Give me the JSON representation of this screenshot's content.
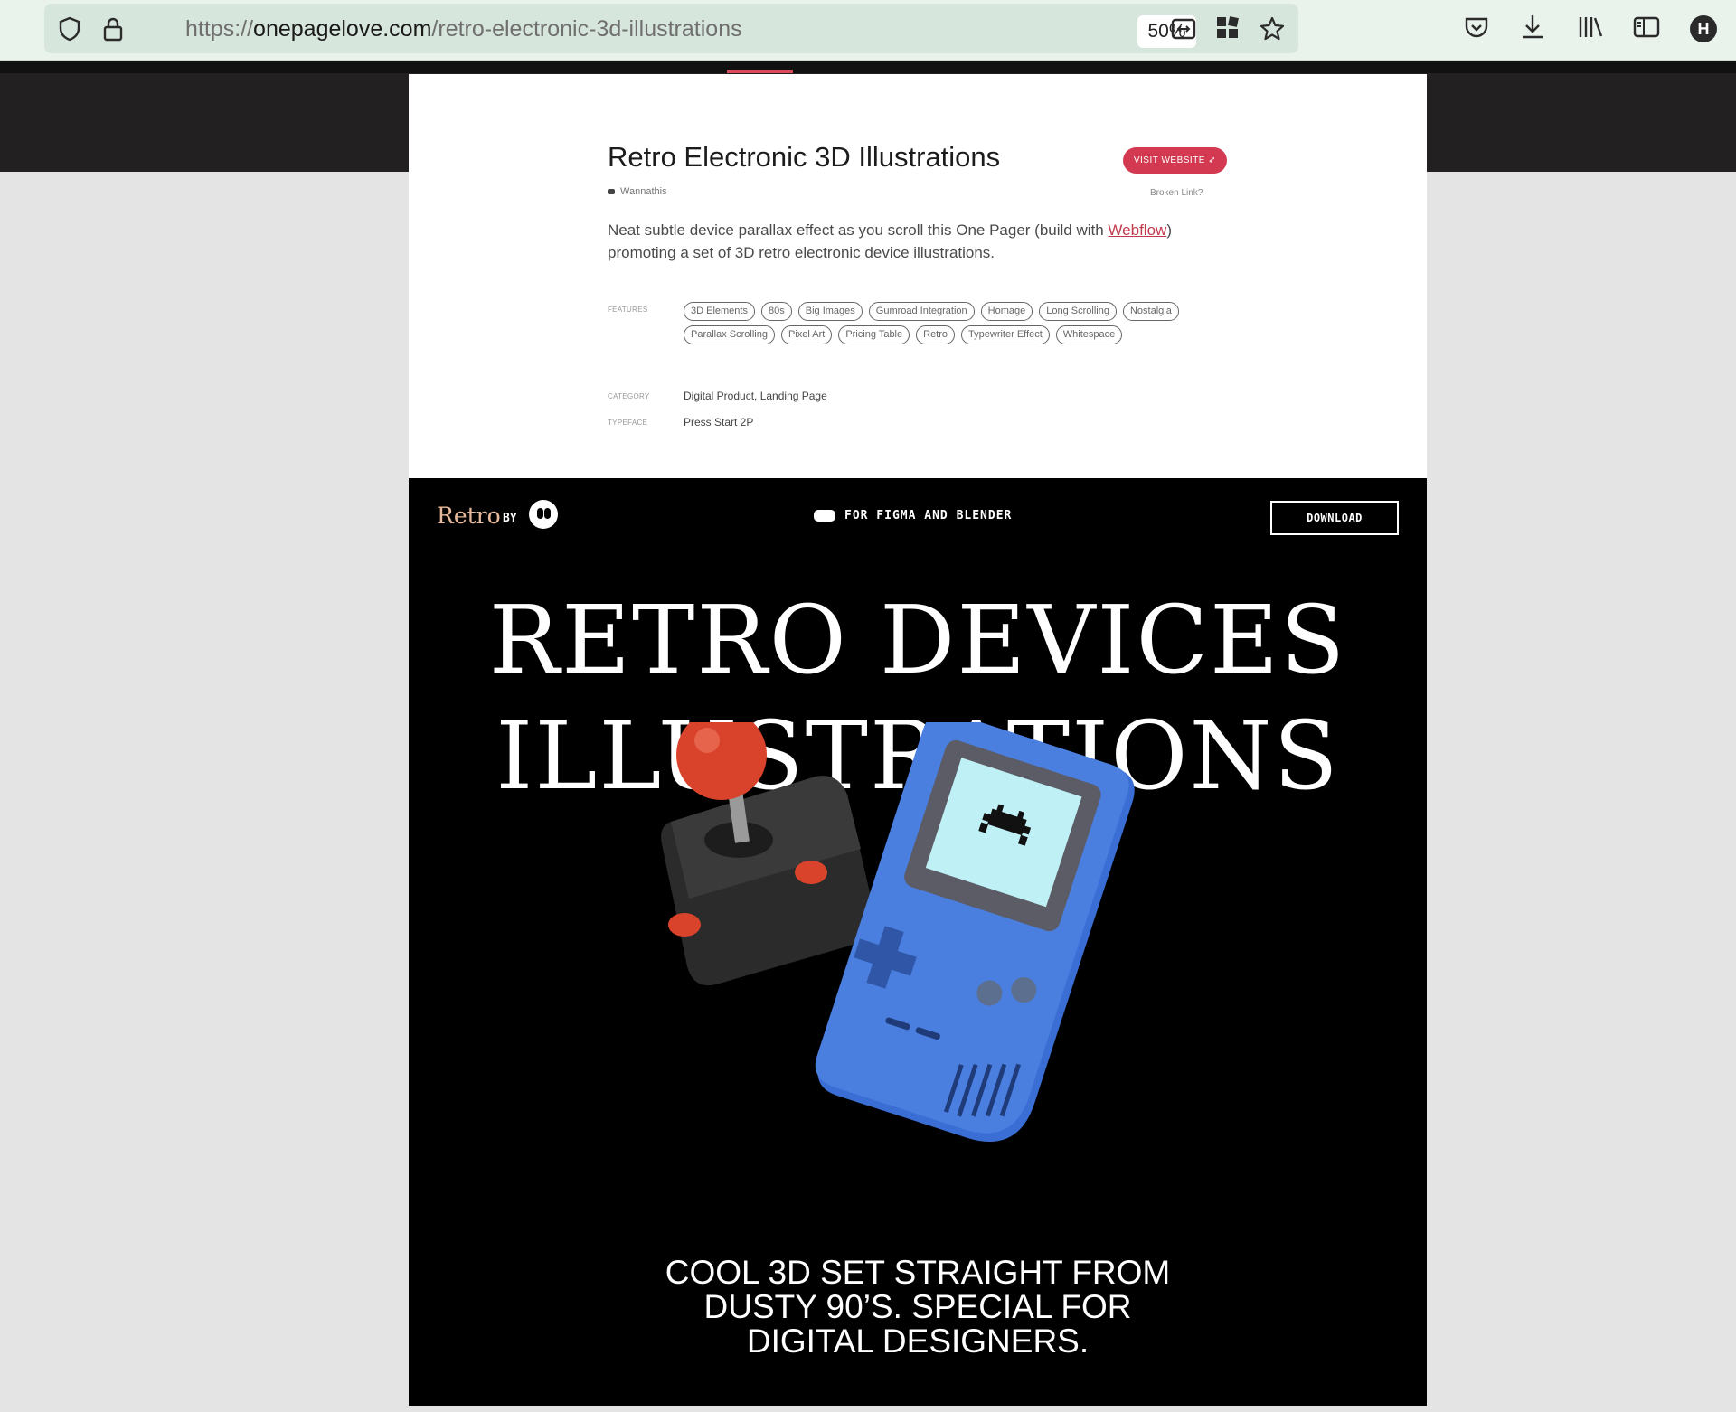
{
  "browser": {
    "url_prefix": "https://",
    "url_domain": "onepagelove.com",
    "url_path": "/retro-electronic-3d-illustrations",
    "zoom": "50%",
    "profile_initial": "H",
    "icons": [
      "shield-icon",
      "lock-icon",
      "reader-view-icon",
      "extensions-icon",
      "bookmark-star-icon",
      "pocket-icon",
      "download-icon",
      "library-icon",
      "sidebar-icon",
      "avatar"
    ]
  },
  "listing": {
    "title": "Retro Electronic 3D Illustrations",
    "visit_label": "VISIT WEBSITE ➶",
    "author": "Wannathis",
    "broken_link": "Broken Link?",
    "description_start": "Neat subtle device parallax effect as you scroll this One Pager (build with ",
    "description_link": "Webflow",
    "description_end": ") promoting a set of 3D retro electronic device illustrations.",
    "features_label": "FEATURES",
    "features": [
      "3D Elements",
      "80s",
      "Big Images",
      "Gumroad Integration",
      "Homage",
      "Long Scrolling",
      "Nostalgia",
      "Parallax Scrolling",
      "Pixel Art",
      "Pricing Table",
      "Retro",
      "Typewriter Effect",
      "Whitespace"
    ],
    "category_label": "CATEGORY",
    "category_value": "Digital Product, Landing Page",
    "typeface_label": "TYPEFACE",
    "typeface_value": "Press Start 2P"
  },
  "site": {
    "logo": "Retro",
    "by": "BY",
    "promo": "FOR FIGMA AND BLENDER",
    "download": "DOWNLOAD",
    "hero_line1": "RETRO DEVICES",
    "hero_line2": "ILLUSTRATIONS",
    "subheading": "COOL 3D SET STRAIGHT FROM DUSTY 90’S. SPECIAL FOR DIGITAL DESIGNERS."
  },
  "colors": {
    "accent": "#d33a52",
    "toolbar": "#e9f3ec",
    "gameboy": "#4a7fe0",
    "joystick_ball": "#d9432b"
  }
}
